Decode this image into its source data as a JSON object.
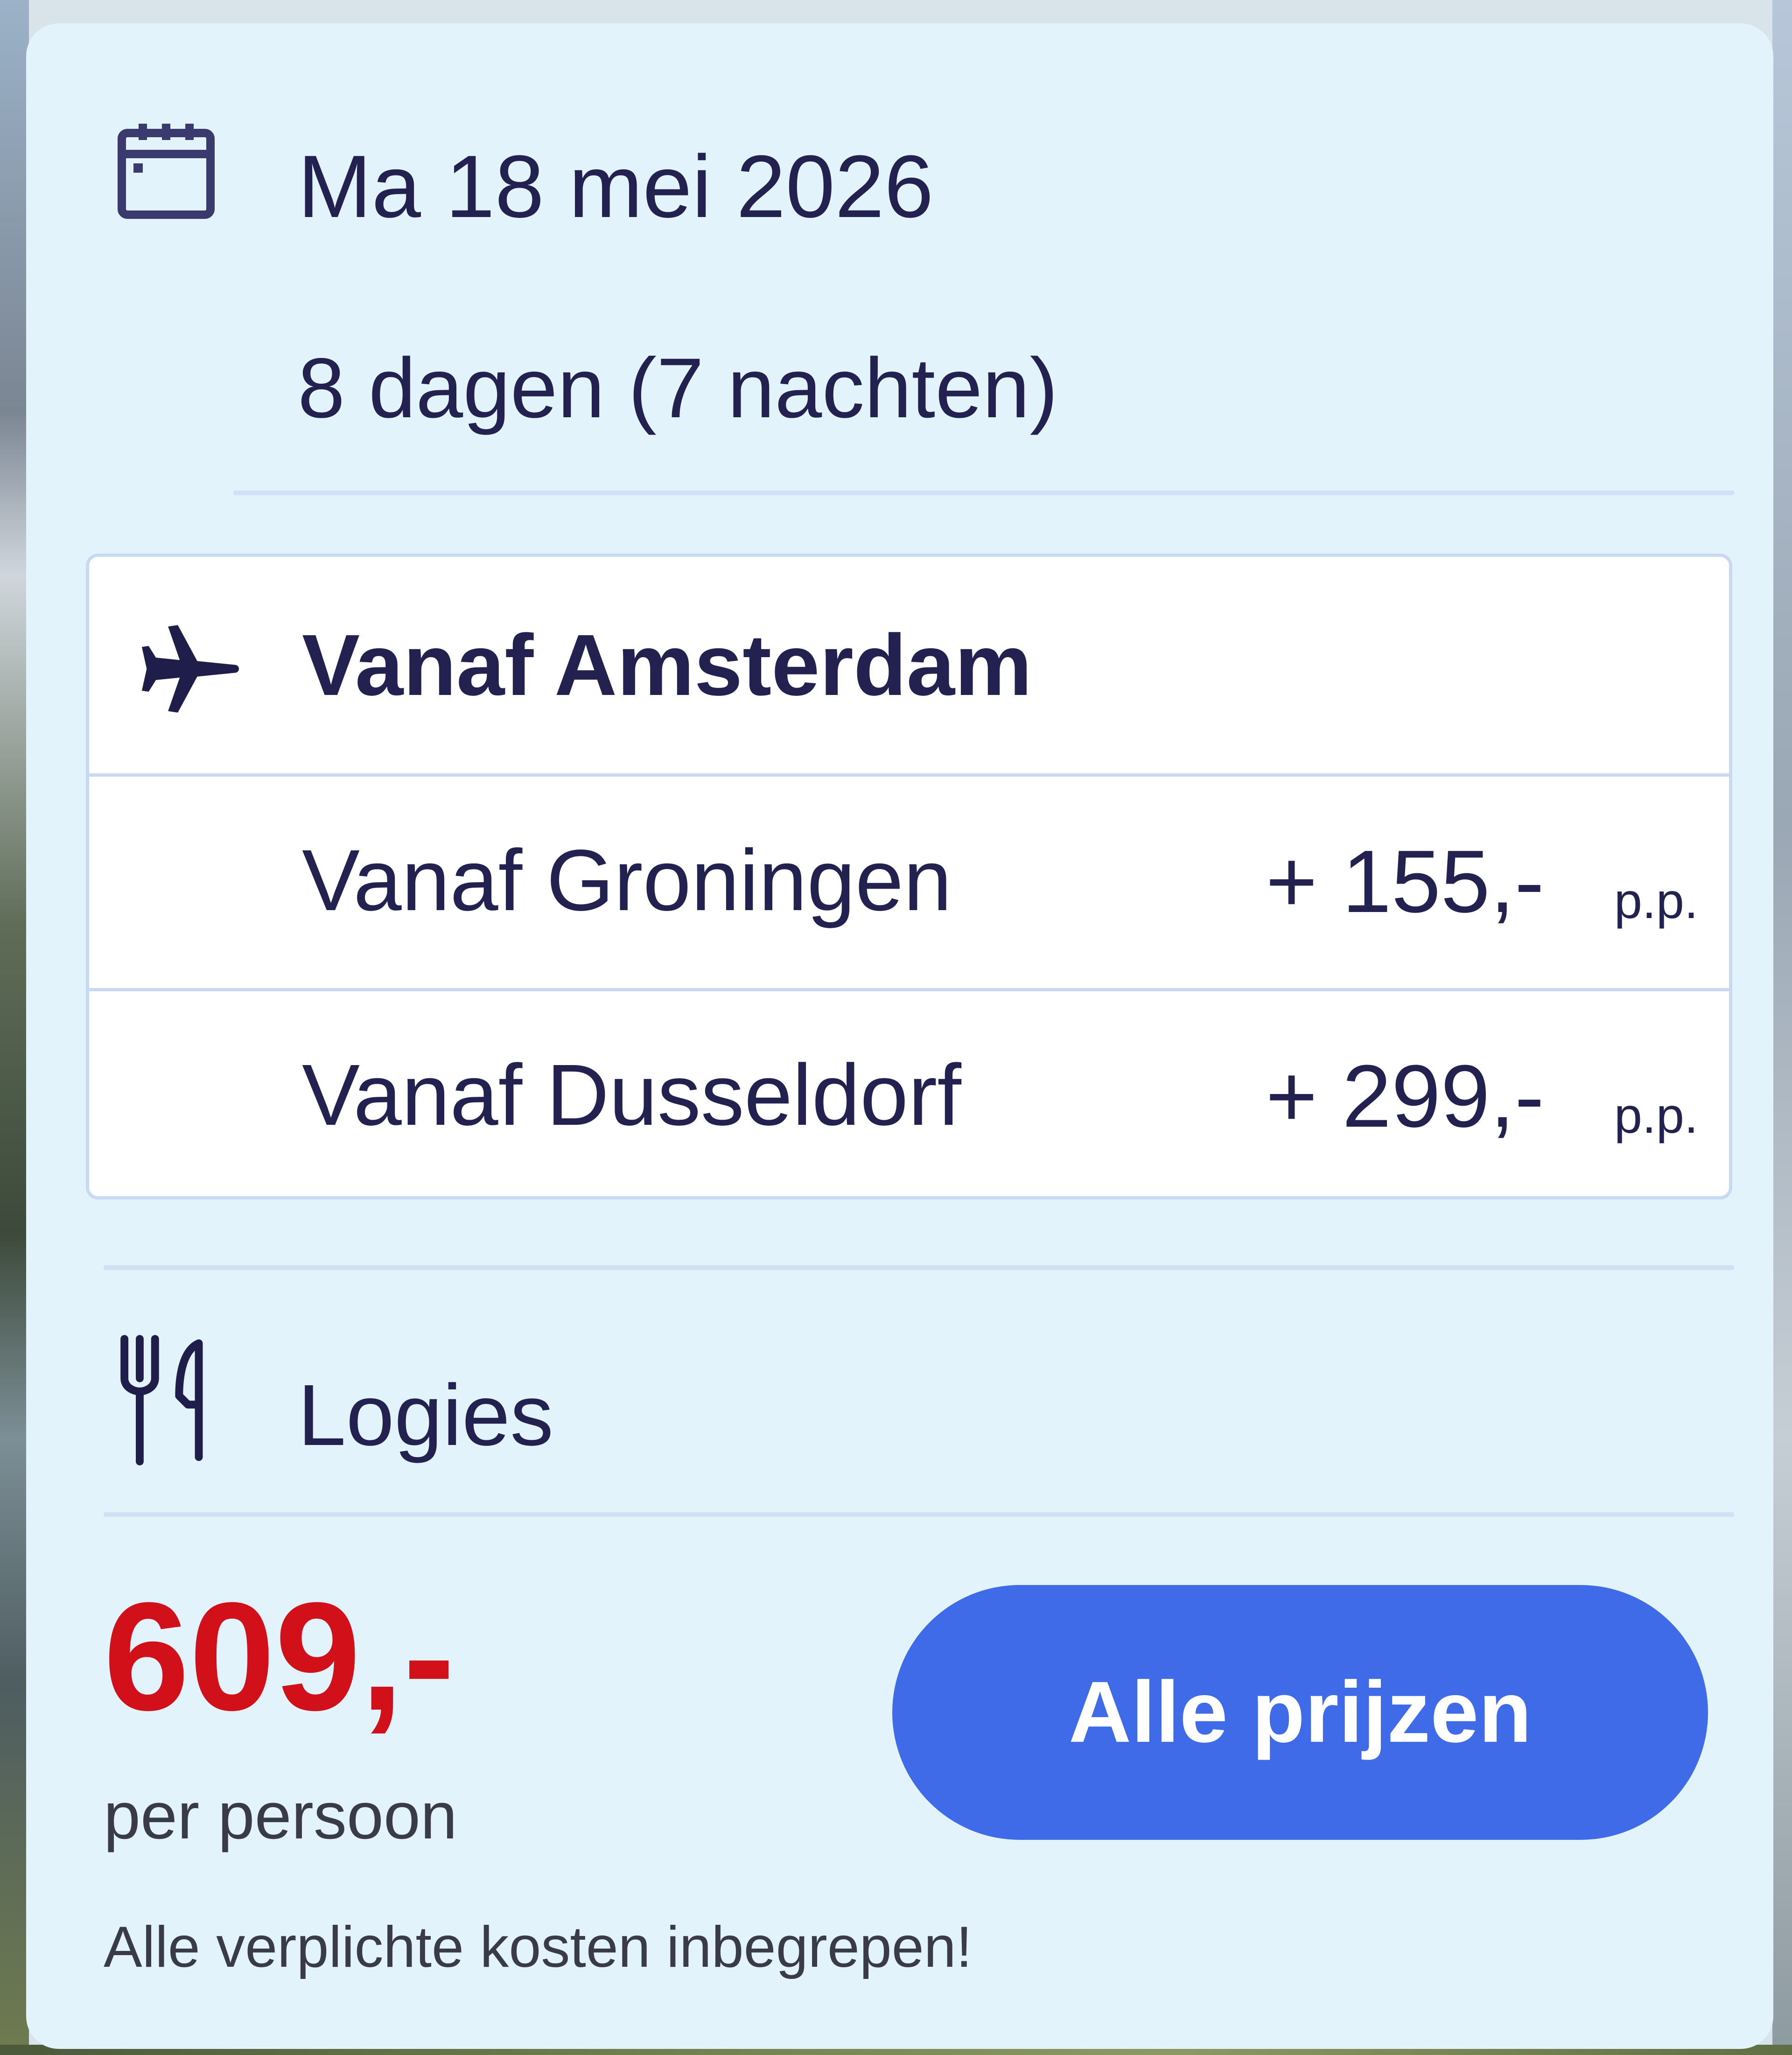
{
  "trip": {
    "date": "Ma 18 mei 2026",
    "duration": "8 dagen (7 nachten)"
  },
  "flights": {
    "primary": {
      "label": "Vanaf Amsterdam",
      "icon": "airplane-icon"
    },
    "options": [
      {
        "label": "Vanaf Groningen",
        "price": "+ 155,-",
        "unit": "p.p."
      },
      {
        "label": "Vanaf Dusseldorf",
        "price": "+ 299,-",
        "unit": "p.p."
      }
    ]
  },
  "board": {
    "label": "Logies",
    "icon": "cutlery-icon"
  },
  "pricing": {
    "price": "609,-",
    "unit": "per persoon",
    "note": "Alle verplichte kosten inbegrepen!"
  },
  "cta": {
    "label": "Alle prijzen"
  },
  "colors": {
    "card_background": "#e2f3fc",
    "text_primary": "#22214f",
    "price_red": "#d1101a",
    "button_blue": "#3f6ae8",
    "divider": "#cfe1f3"
  }
}
